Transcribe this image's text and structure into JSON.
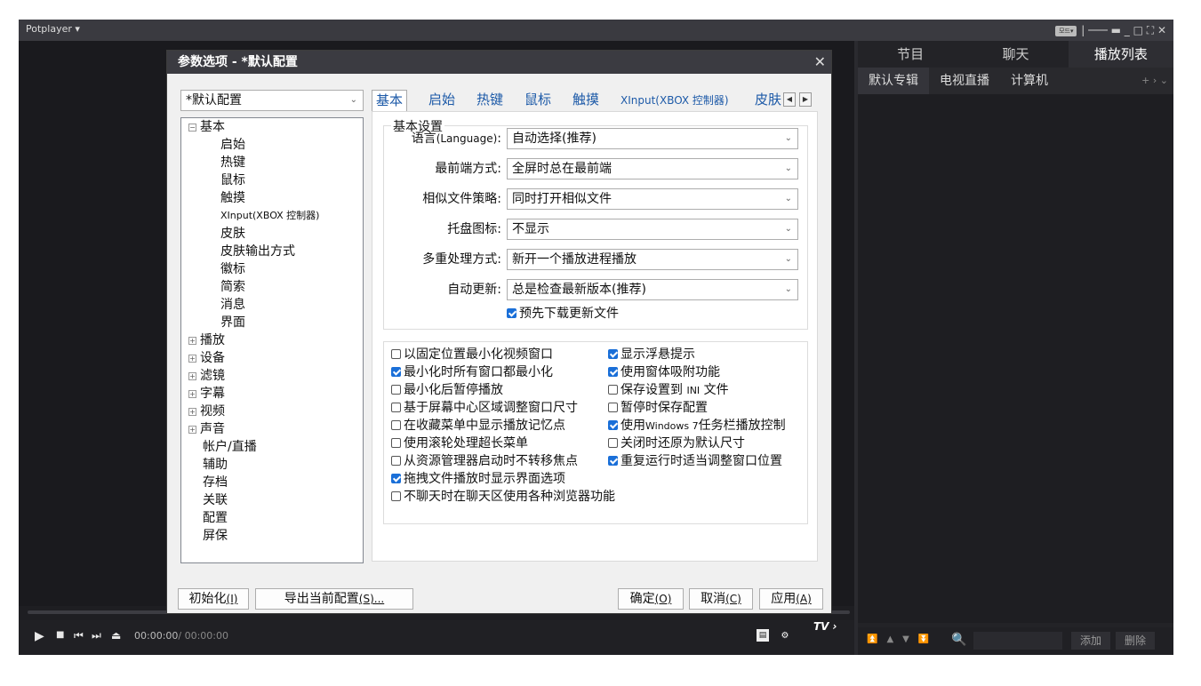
{
  "app": {
    "title": "Potplayer ▾",
    "mode_badge": "모드▾",
    "win_controls": "| ─── ▬  _  □  ⛶  ✕"
  },
  "player": {
    "time_current": "00:00:00",
    "time_total": "/ 00:00:00",
    "tv_label": "TV ›"
  },
  "right_panel": {
    "tabs": [
      "节目",
      "聊天",
      "播放列表"
    ],
    "subtabs": [
      "默认专辑",
      "电视直播",
      "计算机"
    ],
    "subtab_ctrl": "+ › ⌄",
    "add_btn": "添加",
    "del_btn": "删除"
  },
  "dialog": {
    "title": "参数选项 - *默认配置",
    "close": "✕",
    "profile_select": "*默认配置",
    "tree": {
      "basic": "基本",
      "startup": "启始",
      "hotkey": "热键",
      "mouse": "鼠标",
      "touch": "触摸",
      "xinput": "XInput(XBOX 控制器)",
      "skin": "皮肤",
      "skin_output": "皮肤输出方式",
      "logo": "徽标",
      "brief": "简索",
      "message": "消息",
      "ui": "界面",
      "play": "播放",
      "device": "设备",
      "filter": "滤镜",
      "subtitle": "字幕",
      "video": "视频",
      "audio": "声音",
      "account": "帐户/直播",
      "assist": "辅助",
      "archive": "存档",
      "assoc": "关联",
      "config": "配置",
      "screensaver": "屏保"
    },
    "tabs": {
      "basic": "基本",
      "startup": "启始",
      "hotkey": "热键",
      "mouse": "鼠标",
      "touch": "触摸",
      "xinput": "XInput(XBOX 控制器)",
      "skin": "皮肤"
    },
    "group_title": "基本设置",
    "settings": {
      "language_label": "语言",
      "language_label_small": "(Language)",
      "language_colon": ":",
      "language_value": "自动选择(推荐)",
      "topmost_label": "最前端方式:",
      "topmost_value": "全屏时总在最前端",
      "similar_label": "相似文件策略:",
      "similar_value": "同时打开相似文件",
      "tray_label": "托盘图标:",
      "tray_value": "不显示",
      "multi_label": "多重处理方式:",
      "multi_value": "新开一个播放进程播放",
      "update_label": "自动更新:",
      "update_value": "总是检查最新版本(推荐)",
      "predownload": "预先下载更新文件"
    },
    "checkboxes_left": [
      {
        "label": "以固定位置最小化视频窗口",
        "checked": false
      },
      {
        "label": "最小化时所有窗口都最小化",
        "checked": true
      },
      {
        "label": "最小化后暂停播放",
        "checked": false
      },
      {
        "label": "基于屏幕中心区域调整窗口尺寸",
        "checked": false
      },
      {
        "label": "在收藏菜单中显示播放记忆点",
        "checked": false
      },
      {
        "label": "使用滚轮处理超长菜单",
        "checked": false
      },
      {
        "label": "从资源管理器启动时不转移焦点",
        "checked": false
      },
      {
        "label": "拖拽文件播放时显示界面选项",
        "checked": true
      },
      {
        "label": "不聊天时在聊天区使用各种浏览器功能",
        "checked": false
      }
    ],
    "checkboxes_right": [
      {
        "label": "显示浮悬提示",
        "checked": true
      },
      {
        "label": "使用窗体吸附功能",
        "checked": true
      },
      {
        "label": "保存设置到",
        "small": "INI",
        "label2": "文件",
        "checked": false
      },
      {
        "label": "暂停时保存配置",
        "checked": false
      },
      {
        "label": "使用",
        "small": "Windows 7",
        "label2": "任务栏播放控制",
        "checked": true
      },
      {
        "label": "关闭时还原为默认尺寸",
        "checked": false
      },
      {
        "label": "重复运行时适当调整窗口位置",
        "checked": true
      }
    ],
    "buttons": {
      "init": "初始化",
      "init_key": "(I)",
      "export": "导出当前配置",
      "export_key": "(S)...",
      "ok": "确定",
      "ok_key": "(O)",
      "cancel": "取消",
      "cancel_key": "(C)",
      "apply": "应用",
      "apply_key": "(A)"
    }
  }
}
